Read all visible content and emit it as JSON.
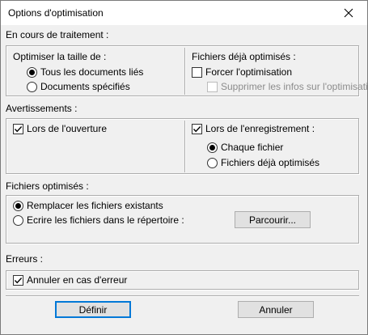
{
  "window": {
    "title": "Options d'optimisation"
  },
  "processing": {
    "heading": "En cours de traitement :",
    "size_group": {
      "label": "Optimiser la taille de :",
      "options": [
        {
          "label": "Tous les documents liés",
          "selected": true
        },
        {
          "label": "Documents spécifiés",
          "selected": false
        }
      ]
    },
    "optimized_group": {
      "label": "Fichiers déjà optimisés :",
      "force_label": "Forcer l'optimisation",
      "force_checked": false,
      "remove_info_label": "Supprimer les infos sur l'optimisation",
      "remove_info_checked": false,
      "remove_info_enabled": false
    }
  },
  "warnings": {
    "heading": "Avertissements :",
    "on_open_label": "Lors de l'ouverture",
    "on_open_checked": true,
    "on_save_label": "Lors de l'enregistrement :",
    "on_save_checked": true,
    "save_options": [
      {
        "label": "Chaque fichier",
        "selected": true
      },
      {
        "label": "Fichiers déjà optimisés",
        "selected": false
      }
    ]
  },
  "optimized_files": {
    "heading": "Fichiers optimisés :",
    "options": [
      {
        "label": "Remplacer les fichiers existants",
        "selected": true
      },
      {
        "label": "Ecrire les fichiers dans le répertoire :",
        "selected": false
      }
    ],
    "browse_label": "Parcourir..."
  },
  "errors": {
    "heading": "Erreurs :",
    "cancel_on_error_label": "Annuler en cas d'erreur",
    "cancel_on_error_checked": true
  },
  "buttons": {
    "define_label": "Définir",
    "cancel_label": "Annuler"
  }
}
